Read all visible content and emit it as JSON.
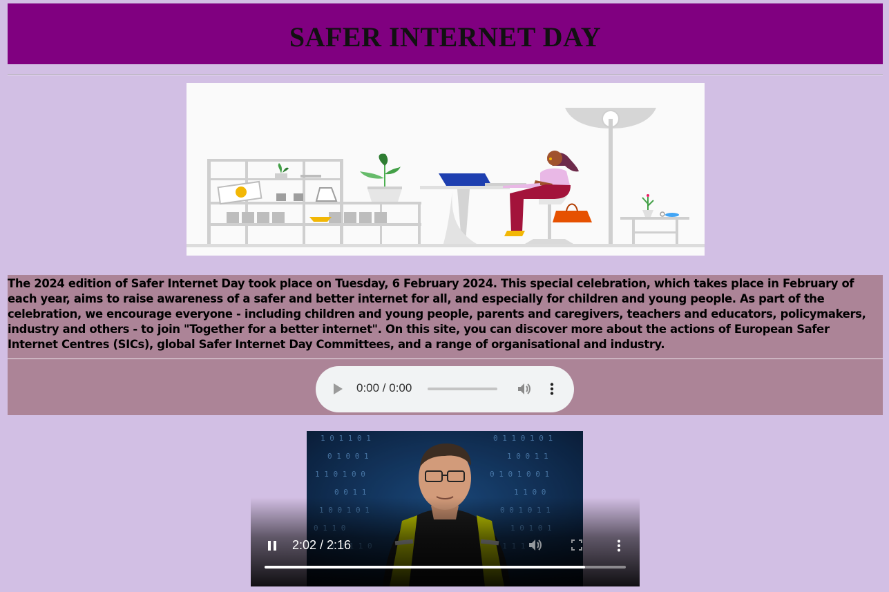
{
  "header": {
    "title": "SAFER INTERNET DAY"
  },
  "hero_image": {
    "alt": "woman working on laptop at desk illustration"
  },
  "intro": {
    "text": "The 2024 edition of Safer Internet Day took place on Tuesday, 6 February 2024. This special celebration, which takes place in February of each year, aims to raise awareness of a safer and better internet for all, and especially for children and young people. As part of the celebration, we encourage everyone - including children and young people, parents and caregivers, teachers and educators, policymakers, industry and others - to join \"Together for a better internet\". On this site, you can discover more about the actions of European Safer Internet Centres (SICs), global Safer Internet Day Committees, and a range of organisational and industry."
  },
  "audio_player": {
    "time": "0:00 / 0:00",
    "progress": 0,
    "icons": [
      "play-icon",
      "volume-icon",
      "more-options-icon"
    ]
  },
  "video_player": {
    "time": "2:02 / 2:16",
    "progress": 0.888,
    "icons": [
      "pause-icon",
      "mute-icon",
      "fullscreen-icon",
      "more-options-icon"
    ]
  },
  "colors": {
    "page_background": "#d2bfe4",
    "header_background": "#800080",
    "section_background": "#ac8497"
  }
}
